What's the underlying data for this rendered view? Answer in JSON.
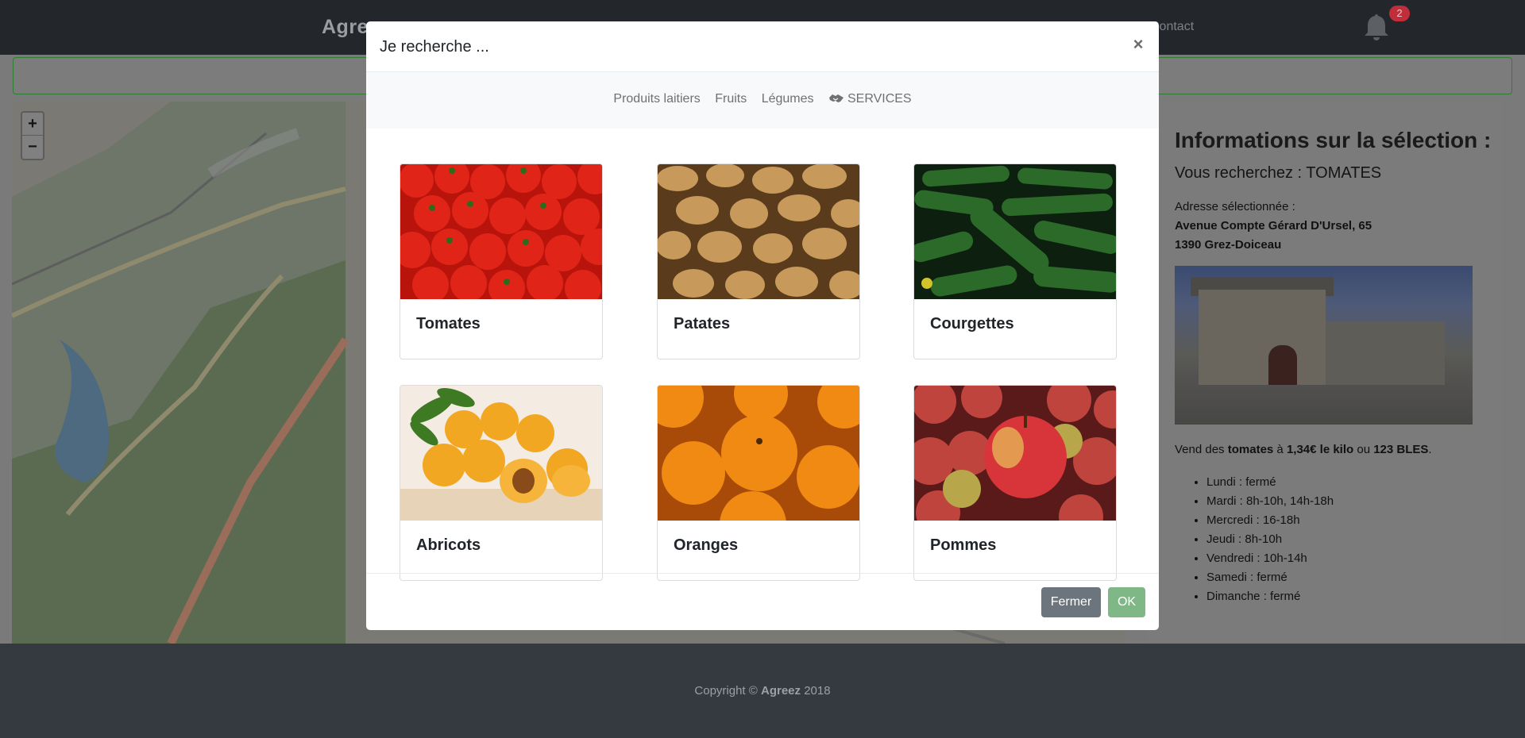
{
  "navbar": {
    "brand": "Agreez",
    "contact": "Contact",
    "notification_count": "2"
  },
  "map": {
    "zoom_in": "+",
    "zoom_out": "−"
  },
  "info": {
    "title": "Informations sur la sélection :",
    "search_prefix": "Vous recherchez : ",
    "search_value": "TOMATES",
    "address_label": "Adresse sélectionnée :",
    "address_line1": "Avenue Compte Gérard D'Ursel, 65",
    "address_line2": "1390 Grez-Doiceau",
    "sells_prefix": "Vend des ",
    "sells_product": "tomates",
    "sells_mid": " à ",
    "sells_price": "1,34€ le kilo",
    "sells_or": " ou ",
    "sells_bles": "123 BLES",
    "sells_end": ".",
    "hours": [
      "Lundi : fermé",
      "Mardi : 8h-10h, 14h-18h",
      "Mercredi : 16-18h",
      "Jeudi : 8h-10h",
      "Vendredi : 10h-14h",
      "Samedi : fermé",
      "Dimanche : fermé"
    ]
  },
  "footer": {
    "prefix": "Copyright © ",
    "brand": "Agreez",
    "year": " 2018"
  },
  "modal": {
    "title": "Je recherche ...",
    "close_glyph": "×",
    "categories": [
      "Produits laitiers",
      "Fruits",
      "Légumes",
      "SERVICES"
    ],
    "products": [
      "Tomates",
      "Patates",
      "Courgettes",
      "Abricots",
      "Oranges",
      "Pommes"
    ],
    "button_close": "Fermer",
    "button_ok": "OK"
  },
  "colors": {
    "navbar": "#23272b",
    "close_button": "#6c757d",
    "ok_button": "#7fb886",
    "badge": "#c22d3a"
  }
}
